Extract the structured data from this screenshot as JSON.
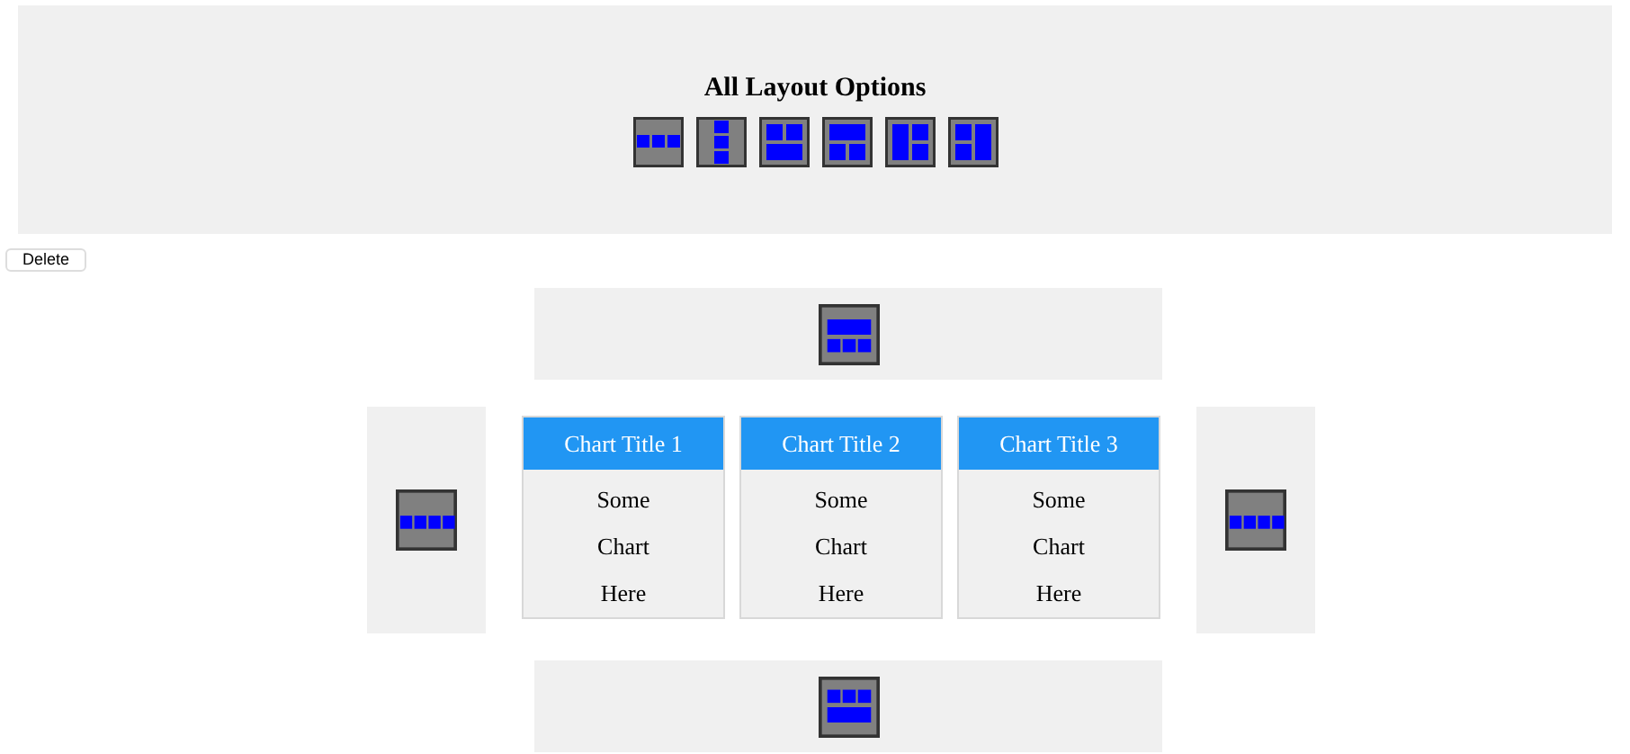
{
  "header": {
    "title": "All Layout Options",
    "layout_options": [
      {
        "kind": "row3"
      },
      {
        "kind": "column3"
      },
      {
        "kind": "two-over-one"
      },
      {
        "kind": "one-over-two"
      },
      {
        "kind": "tall-left"
      },
      {
        "kind": "tall-right"
      }
    ]
  },
  "delete_button": "Delete",
  "drop_zones": {
    "top": {
      "kind": "one-over-three"
    },
    "left": {
      "kind": "row4"
    },
    "right": {
      "kind": "row4"
    },
    "bottom": {
      "kind": "three-over-one"
    }
  },
  "charts": [
    {
      "title": "Chart Title 1",
      "body": [
        "Some",
        "Chart",
        "Here"
      ]
    },
    {
      "title": "Chart Title 2",
      "body": [
        "Some",
        "Chart",
        "Here"
      ]
    },
    {
      "title": "Chart Title 3",
      "body": [
        "Some",
        "Chart",
        "Here"
      ]
    }
  ]
}
